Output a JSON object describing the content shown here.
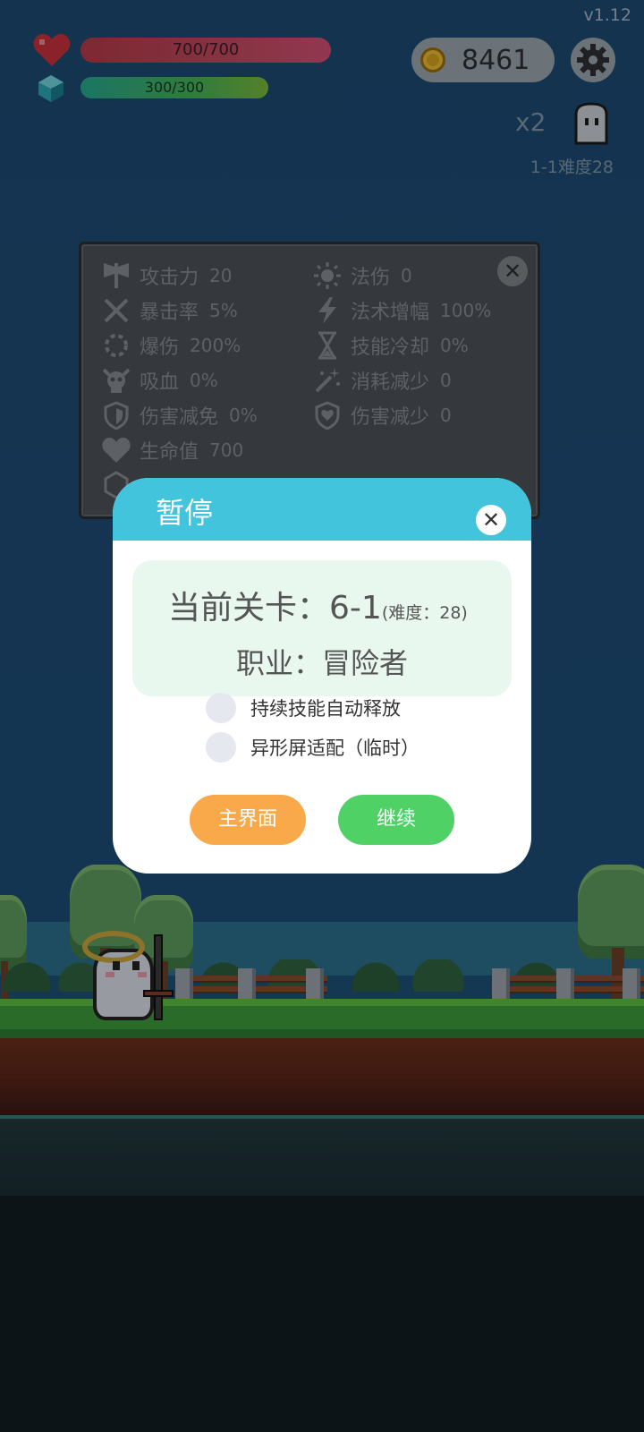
{
  "hud": {
    "version": "v1.12",
    "hp_text": "700/700",
    "hp_fraction": 1.0,
    "mp_text": "300/300",
    "mp_fraction": 1.0,
    "coins": "8461",
    "speed": "x2",
    "level_label": "1-1难度28"
  },
  "stats": {
    "left": [
      {
        "icon": "axe-icon",
        "label": "攻击力",
        "value": "20"
      },
      {
        "icon": "crit-icon",
        "label": "暴击率",
        "value": "5%"
      },
      {
        "icon": "burst-icon",
        "label": "爆伤",
        "value": "200%"
      },
      {
        "icon": "skull-icon",
        "label": "吸血",
        "value": "0%"
      },
      {
        "icon": "shield-icon",
        "label": "伤害减免",
        "value": "0%"
      },
      {
        "icon": "heart-icon",
        "label": "生命值",
        "value": "700"
      }
    ],
    "right": [
      {
        "icon": "sun-icon",
        "label": "法伤",
        "value": "0"
      },
      {
        "icon": "lightning-icon",
        "label": "法术增幅",
        "value": "100%"
      },
      {
        "icon": "hourglass-icon",
        "label": "技能冷却",
        "value": "0%"
      },
      {
        "icon": "wand-icon",
        "label": "消耗减少",
        "value": "0"
      },
      {
        "icon": "shield-heart-icon",
        "label": "伤害减少",
        "value": "0"
      }
    ],
    "close_label": "✕"
  },
  "dialog": {
    "title": "暂停",
    "close_label": "✕",
    "stage_prefix": "当前关卡：",
    "stage_value": "6-1",
    "stage_difficulty": "(难度：28)",
    "job": "职业：冒险者",
    "options": [
      "持续技能自动释放",
      "异形屏适配（临时）"
    ],
    "home_button": "主界面",
    "continue_button": "继续"
  },
  "colors": {
    "header": "#41c4dc",
    "home_button": "#f9a84a",
    "continue_button": "#4fd166",
    "info_box": "#e9f8ef"
  }
}
